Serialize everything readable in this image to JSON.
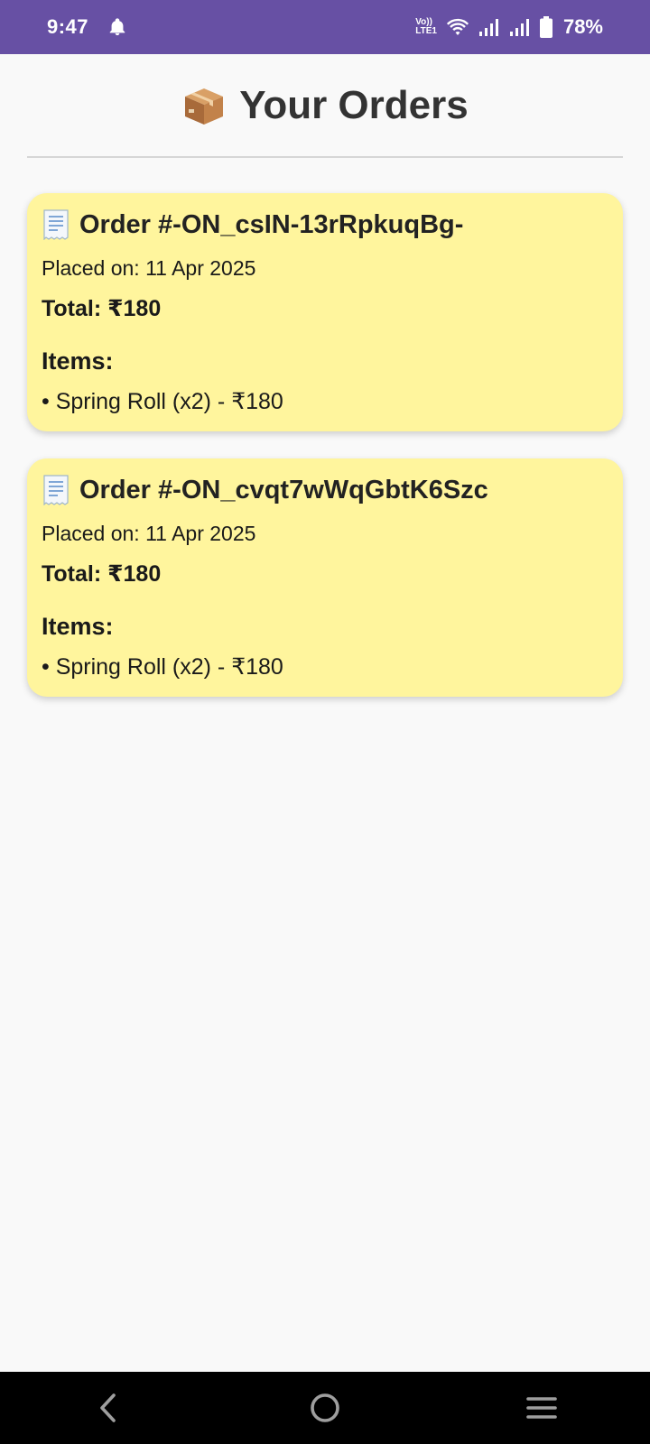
{
  "status_bar": {
    "time": "9:47",
    "battery_percent": "78%",
    "network_label_top": "Vo))",
    "network_label_bottom": "LTE1",
    "icons": [
      "bell-icon",
      "volte-icon",
      "wifi-icon",
      "signal-icon",
      "signal-icon",
      "battery-icon"
    ],
    "background_color": "#6750a4"
  },
  "header": {
    "icon": "package-icon",
    "title": "Your Orders"
  },
  "orders": [
    {
      "icon": "receipt-icon",
      "title": "Order #-ON_csIN-13rRpkuqBg-",
      "placed_on": "Placed on: 11 Apr 2025",
      "total": "Total: ₹180",
      "items_heading": "Items:",
      "items": [
        "• Spring Roll (x2) - ₹180"
      ]
    },
    {
      "icon": "receipt-icon",
      "title": "Order #-ON_cvqt7wWqGbtK6Szc",
      "placed_on": "Placed on: 11 Apr 2025",
      "total": "Total: ₹180",
      "items_heading": "Items:",
      "items": [
        "• Spring Roll (x2) - ₹180"
      ]
    }
  ],
  "card_color": "#fff59d",
  "nav_bar": {
    "buttons": [
      "back-icon",
      "home-icon",
      "recents-icon"
    ]
  }
}
